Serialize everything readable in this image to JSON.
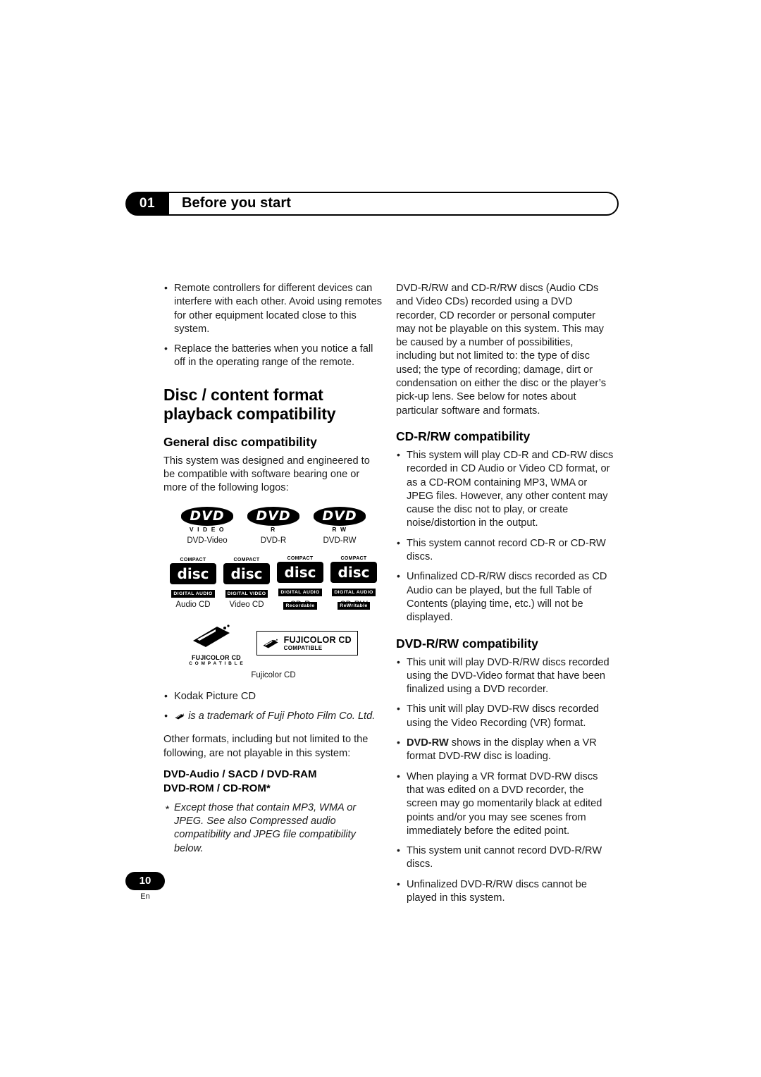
{
  "header": {
    "chapter_number": "01",
    "title": "Before you start"
  },
  "left_column": {
    "intro_bullets": [
      "Remote controllers for different devices can interfere with each other. Avoid using remotes for other equipment located close to this system.",
      "Replace the batteries when you notice a fall off in the operating range of the remote."
    ],
    "section_heading": "Disc / content format playback compatibility",
    "general_heading": "General disc compatibility",
    "general_paragraph": "This system was designed and engineered to be compatible with software bearing one or more of the following logos:",
    "logos": {
      "dvd_row": [
        {
          "mark": "DVD",
          "sub": "V I D E O",
          "caption": "DVD-Video"
        },
        {
          "mark": "DVD",
          "sub": "R",
          "caption": "DVD-R"
        },
        {
          "mark": "DVD",
          "sub": "R W",
          "caption": "DVD-RW"
        }
      ],
      "cd_row": [
        {
          "top": "COMPACT",
          "disc": "disc",
          "bottom": "DIGITAL AUDIO",
          "inverted": false,
          "caption": "Audio CD"
        },
        {
          "top": "COMPACT",
          "disc": "disc",
          "bottom": "DIGITAL VIDEO",
          "inverted": true,
          "caption": "Video CD"
        },
        {
          "top": "COMPACT",
          "disc": "disc",
          "bottom": "DIGITAL AUDIO",
          "bottom2": "Recordable",
          "inverted": true,
          "caption": "CD-R"
        },
        {
          "top": "COMPACT",
          "disc": "disc",
          "bottom": "DIGITAL AUDIO",
          "bottom2": "ReWritable",
          "inverted": true,
          "caption": "CD-RW"
        }
      ],
      "fuji": {
        "left_label": "FUJICOLOR CD",
        "left_label2": "C O M P A T I B L E",
        "box_line1": "FUJICOLOR CD",
        "box_line2": "COMPATIBLE",
        "caption": "Fujicolor CD"
      }
    },
    "logo_bullets": [
      "Kodak Picture CD",
      "is a trademark of Fuji Photo Film Co. Ltd."
    ],
    "other_formats_paragraph": "Other formats, including but not limited to the following, are not playable in this system:",
    "not_playable_line1": "DVD-Audio / SACD / DVD-RAM",
    "not_playable_line2": "DVD-ROM / CD-ROM*",
    "footnote": "Except those that contain MP3, WMA or JPEG. See also Compressed audio compatibility and JPEG file compatibility below."
  },
  "right_column": {
    "intro_paragraph": "DVD-R/RW and CD-R/RW discs (Audio CDs and Video CDs) recorded using a DVD recorder, CD recorder or personal computer may not be playable on this system. This may be caused by a number of possibilities, including but not limited to: the type of disc used; the type of recording; damage, dirt or condensation on either the disc or the player’s pick-up lens. See below for notes about particular software and formats.",
    "cdrw_heading": "CD-R/RW compatibility",
    "cdrw_bullets": [
      "This system will play CD-R and CD-RW discs recorded in CD Audio or Video CD format, or as a CD-ROM containing MP3, WMA or JPEG files. However, any other content may cause the disc not to play, or create noise/distortion in the output.",
      "This system cannot record CD-R or CD-RW discs.",
      "Unfinalized CD-R/RW discs recorded as CD Audio can be played, but the full Table of Contents (playing time, etc.) will not be displayed."
    ],
    "dvdrw_heading": "DVD-R/RW compatibility",
    "dvdrw_bullets": [
      "This unit will play DVD-R/RW discs recorded using the DVD-Video format that have been finalized using a DVD recorder.",
      "This unit will play DVD-RW discs recorded using the Video Recording (VR) format.",
      "DVD-RW shows in the display when a VR format DVD-RW disc is loading.",
      "When playing a VR format DVD-RW discs that was edited on a DVD recorder, the screen may go momentarily black at edited points and/or you may see scenes from immediately before the edited point.",
      "This system unit cannot record DVD-R/RW discs.",
      "Unfinalized DVD-R/RW discs cannot be played in this system."
    ],
    "dvdrw_bold_prefix": "DVD-RW"
  },
  "footer": {
    "page_number": "10",
    "language": "En"
  }
}
